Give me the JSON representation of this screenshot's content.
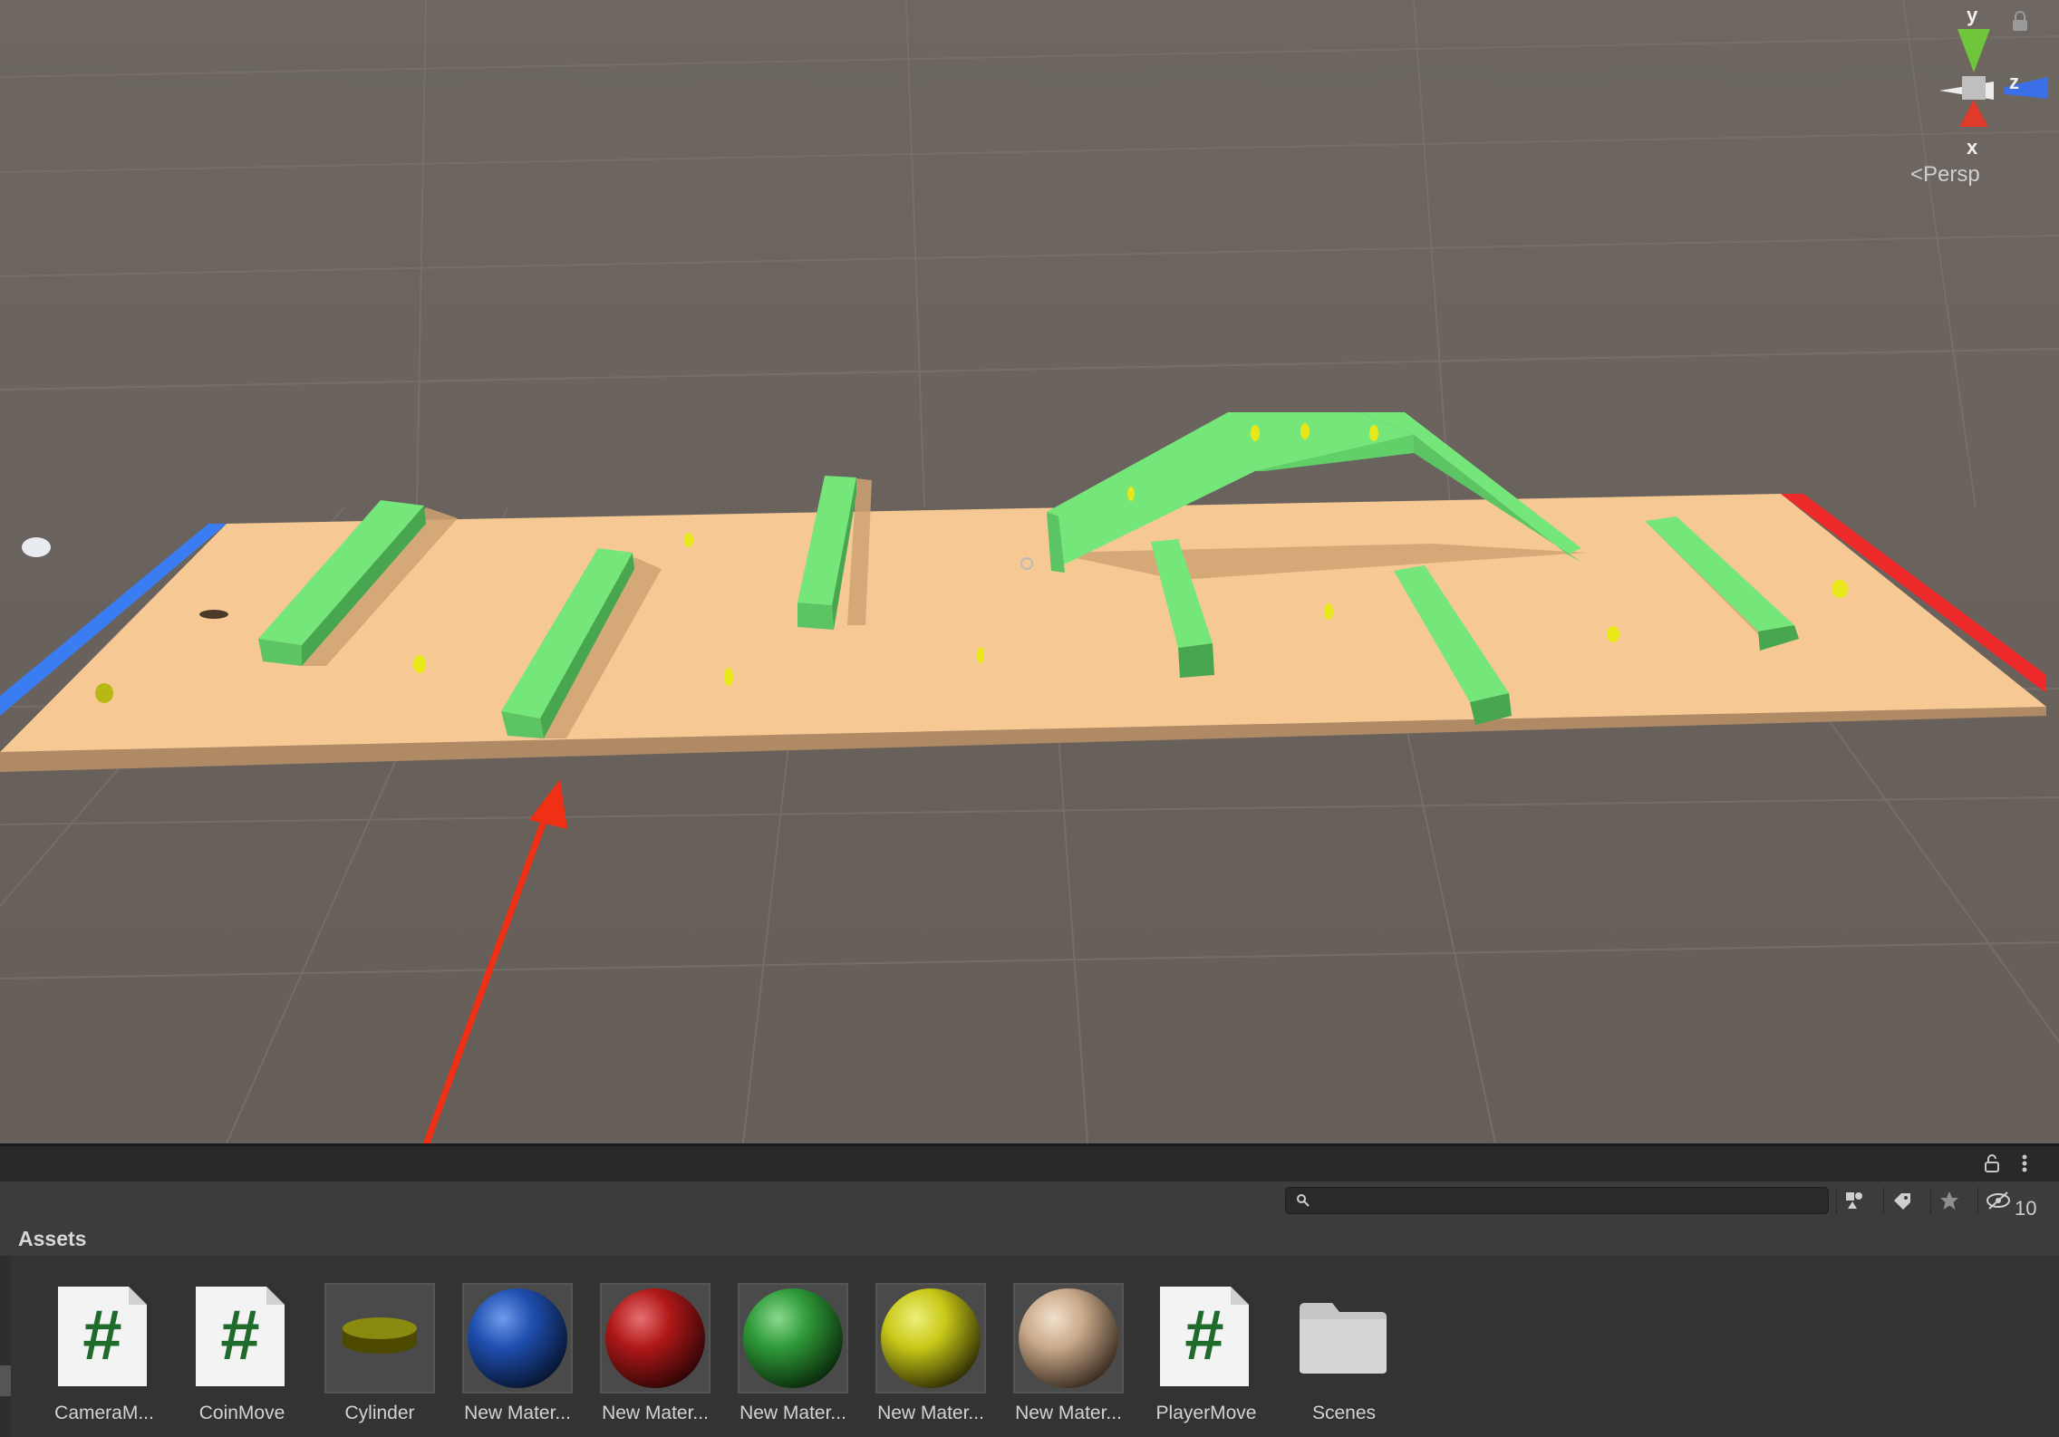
{
  "scene_view": {
    "gizmo": {
      "y_label": "y",
      "z_label": "z",
      "x_label": "x",
      "projection_label": "Persp"
    }
  },
  "project_panel": {
    "search": {
      "value": "",
      "placeholder": ""
    },
    "hidden_count": "10",
    "breadcrumb": "Assets",
    "assets": [
      {
        "label": "CameraM...",
        "kind": "script"
      },
      {
        "label": "CoinMove",
        "kind": "script"
      },
      {
        "label": "Cylinder",
        "kind": "prefab"
      },
      {
        "label": "New Mater...",
        "kind": "material",
        "color": "#1f4fb0"
      },
      {
        "label": "New Mater...",
        "kind": "material",
        "color": "#b01818"
      },
      {
        "label": "New Mater...",
        "kind": "material",
        "color": "#2f9a38"
      },
      {
        "label": "New Mater...",
        "kind": "material",
        "color": "#c8c818"
      },
      {
        "label": "New Mater...",
        "kind": "material",
        "color": "#c9a98a"
      },
      {
        "label": "PlayerMove",
        "kind": "script"
      },
      {
        "label": "Scenes",
        "kind": "folder"
      }
    ]
  },
  "colors": {
    "scene_bg": "#6a625c",
    "floor": "#f6c894",
    "wall": "#74e67a",
    "left_edge": "#3a7df2",
    "right_edge": "#ef2a2a",
    "coin": "#e8e818",
    "annotation_arrow": "#f03015"
  }
}
